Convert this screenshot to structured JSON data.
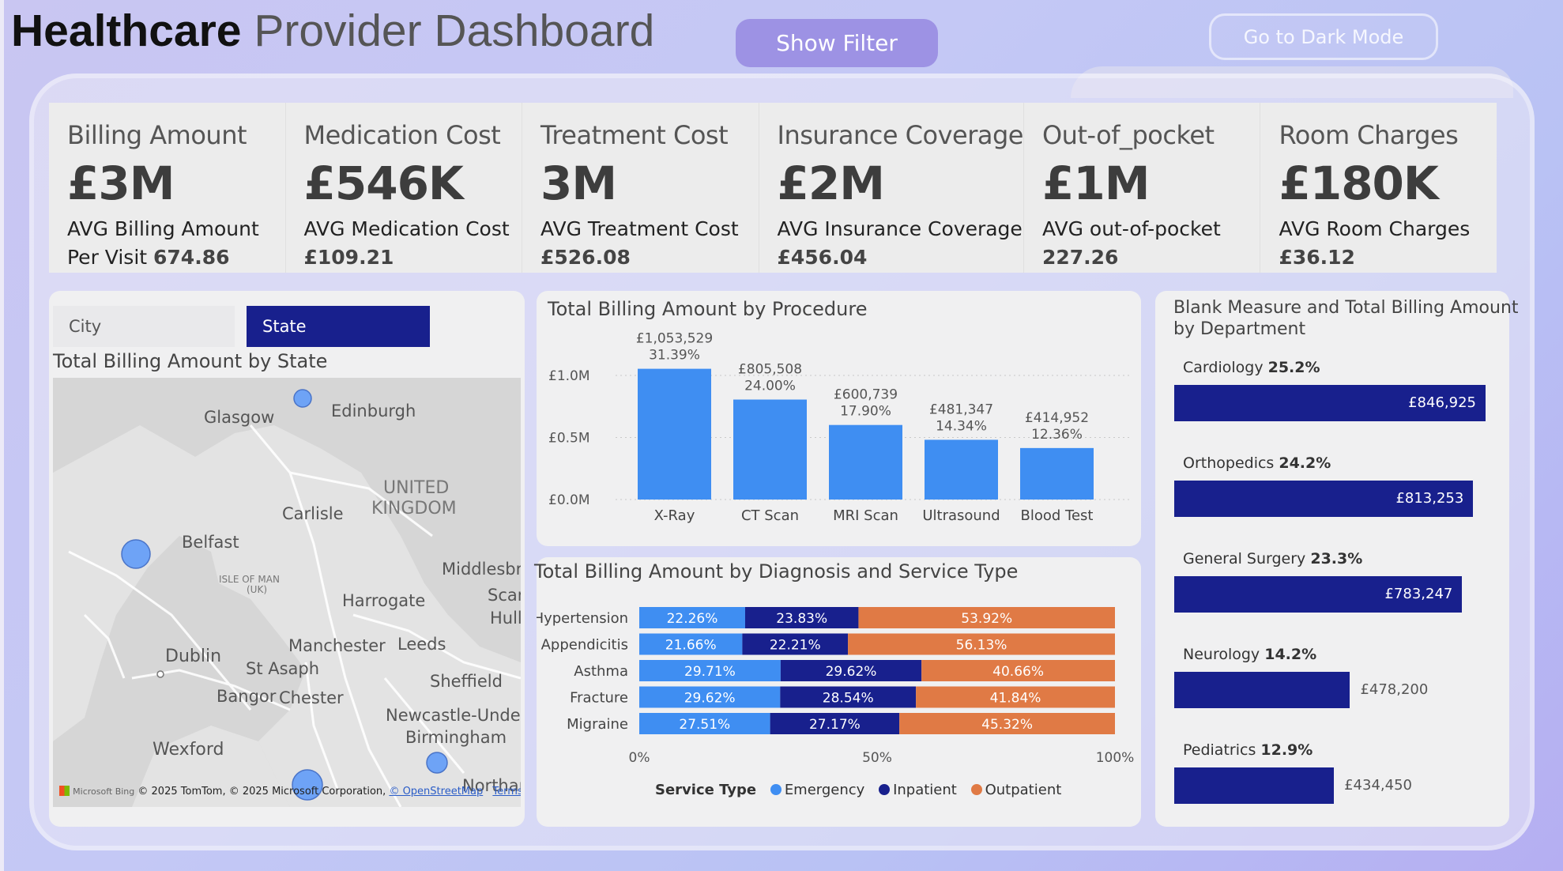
{
  "header": {
    "title_bold": "Healthcare",
    "title_light": "Provider Dashboard",
    "show_filter": "Show Filter",
    "dark_mode": "Go to Dark Mode"
  },
  "kpis": [
    {
      "label": "Billing Amount",
      "value": "£3M",
      "sub": "AVG Billing Amount Per Visit",
      "avg": "674.86"
    },
    {
      "label": "Medication Cost",
      "value": "£546K",
      "sub": "AVG Medication Cost",
      "avg": "£109.21"
    },
    {
      "label": "Treatment Cost",
      "value": "3M",
      "sub": "AVG Treatment Cost",
      "avg": "£526.08"
    },
    {
      "label": "Insurance Coverage",
      "value": "£2M",
      "sub": "AVG Insurance Coverage",
      "avg": "£456.04"
    },
    {
      "label": "Out-of_pocket",
      "value": "£1M",
      "sub": "AVG out-of-pocket",
      "avg": "227.26"
    },
    {
      "label": "Room Charges",
      "value": "£180K",
      "sub": "AVG Room Charges",
      "avg": "£36.12"
    }
  ],
  "map_card": {
    "toggle_city": "City",
    "toggle_state": "State",
    "title": "Total Billing Amount by State",
    "places": [
      "Glasgow",
      "Edinburgh",
      "UNITED",
      "KINGDOM",
      "Carlisle",
      "Belfast",
      "ISLE OF MAN",
      "(UK)",
      "Middlesbr",
      "Scar",
      "Hull",
      "Harrogate",
      "Manchester",
      "Leeds",
      "Dublin",
      "St Asaph",
      "Sheffield",
      "Bangor",
      "Chester",
      "Newcastle-Under",
      "Birmingham",
      "Wexford",
      "Northar"
    ],
    "brand": "Microsoft Bing",
    "attribution": "© 2025 TomTom, © 2025 Microsoft Corporation,",
    "osm_link": "© OpenStreetMap",
    "terms_link": "Terms"
  },
  "procedure_card": {
    "title": "Total Billing Amount by Procedure"
  },
  "diagnosis_card": {
    "title": "Total Billing Amount by Diagnosis and Service Type",
    "legend_title": "Service Type"
  },
  "department_card": {
    "title_line1": "Blank Measure and Total Billing Amount",
    "title_line2": "by Department",
    "departments": [
      {
        "name": "Cardiology",
        "pct": "25.2%",
        "value": "£846,925",
        "amount": 846925
      },
      {
        "name": "Orthopedics",
        "pct": "24.2%",
        "value": "£813,253",
        "amount": 813253
      },
      {
        "name": "General Surgery",
        "pct": "23.3%",
        "value": "£783,247",
        "amount": 783247
      },
      {
        "name": "Neurology",
        "pct": "14.2%",
        "value": "£478,200",
        "amount": 478200
      },
      {
        "name": "Pediatrics",
        "pct": "12.9%",
        "value": "£434,450",
        "amount": 434450
      }
    ]
  },
  "colors": {
    "emergency": "#3f8ef2",
    "inpatient": "#18208d",
    "outpatient": "#e07a45",
    "bar": "#3f8ef2"
  },
  "chart_data": [
    {
      "type": "bar",
      "title": "Total Billing Amount by Procedure",
      "categories": [
        "X-Ray",
        "CT Scan",
        "MRI Scan",
        "Ultrasound",
        "Blood Test"
      ],
      "values": [
        1053529,
        805508,
        600739,
        481347,
        414952
      ],
      "value_labels": [
        "£1,053,529",
        "£805,508",
        "£600,739",
        "£481,347",
        "£414,952"
      ],
      "pct_labels": [
        "31.39%",
        "24.00%",
        "17.90%",
        "14.34%",
        "12.36%"
      ],
      "yticks": [
        "£0.0M",
        "£0.5M",
        "£1.0M"
      ],
      "ylim": [
        0,
        1000000
      ],
      "grid": true
    },
    {
      "type": "bar",
      "orientation": "horizontal-stacked-100",
      "title": "Total Billing Amount by Diagnosis and Service Type",
      "categories": [
        "Hypertension",
        "Appendicitis",
        "Asthma",
        "Fracture",
        "Migraine"
      ],
      "series": [
        {
          "name": "Emergency",
          "values": [
            22.26,
            21.66,
            29.71,
            29.62,
            27.51
          ]
        },
        {
          "name": "Inpatient",
          "values": [
            23.83,
            22.21,
            29.62,
            28.54,
            27.17
          ]
        },
        {
          "name": "Outpatient",
          "values": [
            53.92,
            56.13,
            40.66,
            41.84,
            45.32
          ]
        }
      ],
      "xticks": [
        "0%",
        "50%",
        "100%"
      ],
      "legend": "bottom"
    },
    {
      "type": "bar",
      "orientation": "horizontal",
      "title": "Blank Measure and Total Billing Amount by Department",
      "categories": [
        "Cardiology",
        "Orthopedics",
        "General Surgery",
        "Neurology",
        "Pediatrics"
      ],
      "values": [
        846925,
        813253,
        783247,
        478200,
        434450
      ]
    }
  ]
}
